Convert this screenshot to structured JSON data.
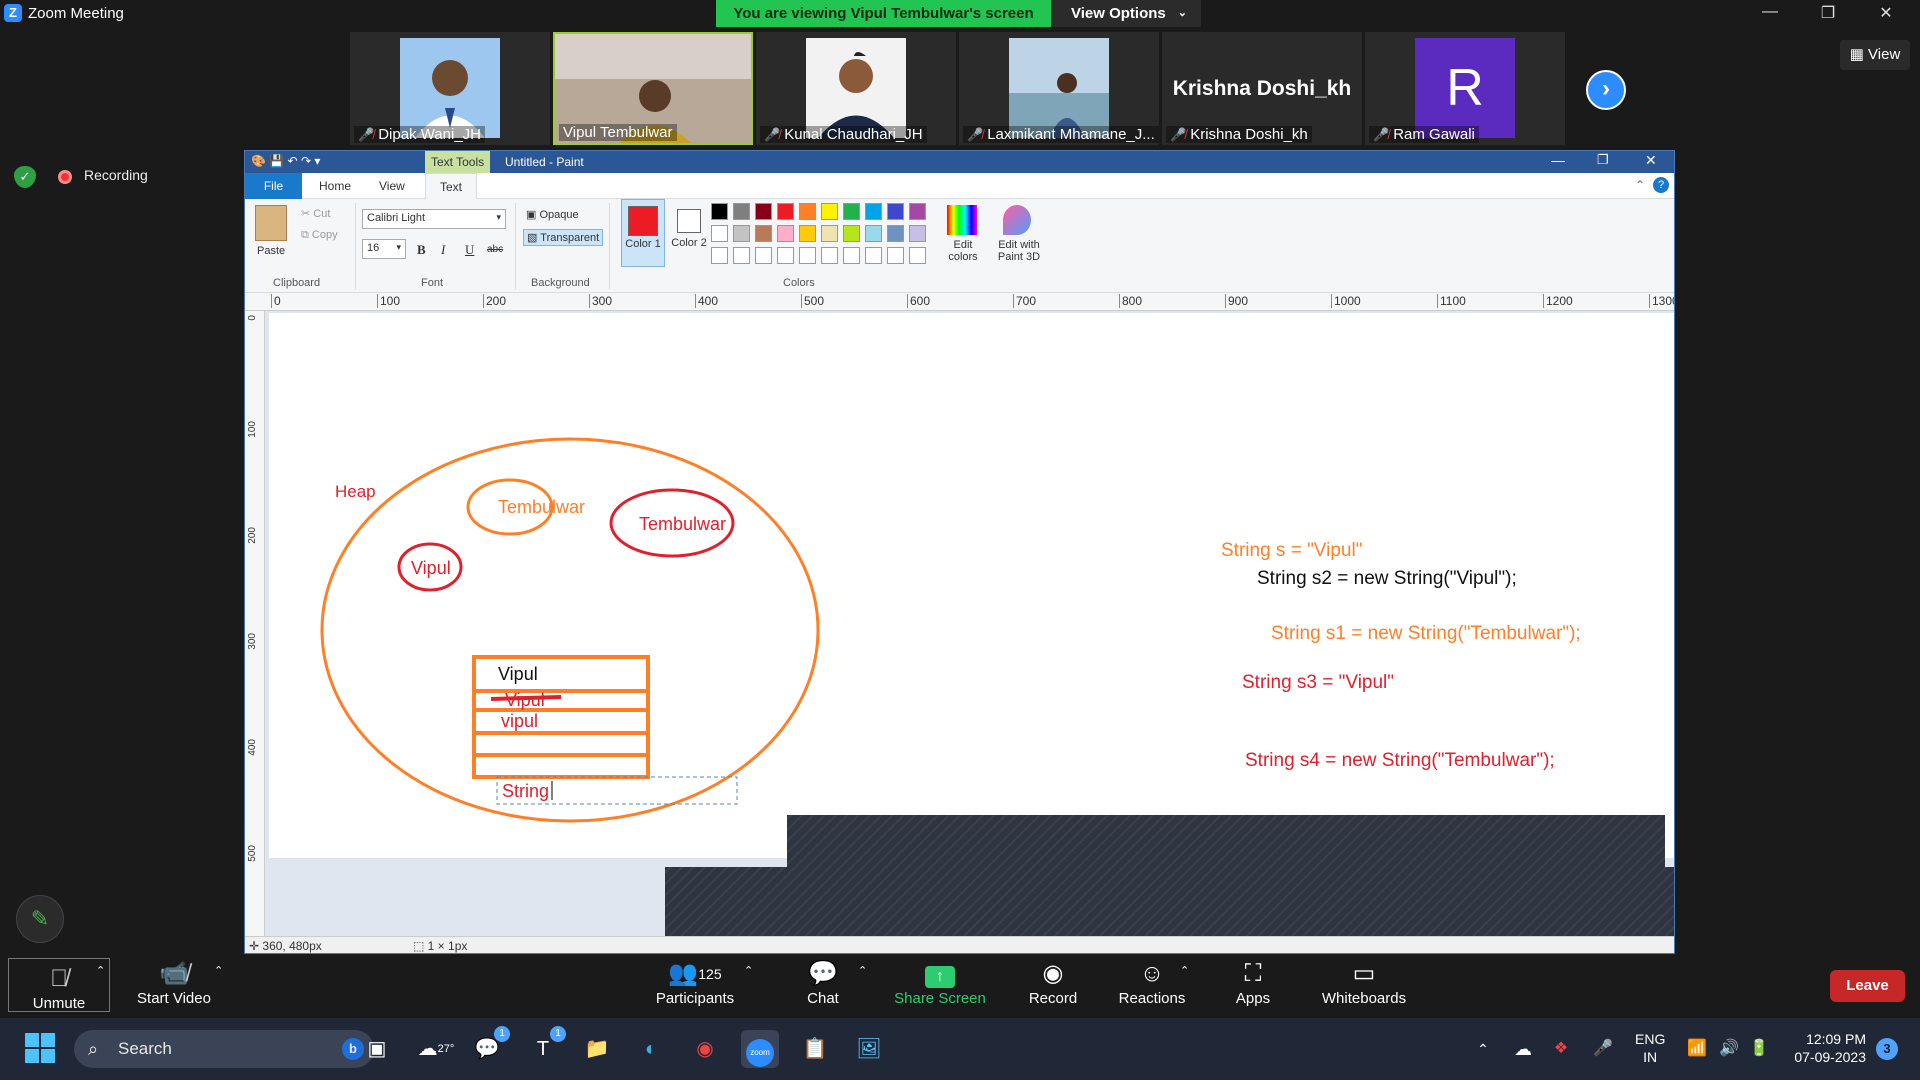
{
  "window": {
    "title": "Zoom Meeting"
  },
  "share_banner": {
    "text": "You are viewing Vipul Tembulwar's screen",
    "view_options": "View Options"
  },
  "participants": [
    {
      "name": "Dipak Wani_JH",
      "muted": true
    },
    {
      "name": "Vipul Tembulwar",
      "muted": false
    },
    {
      "name": "Kunal Chaudhari_JH",
      "muted": true
    },
    {
      "name": "Laxmikant Mhamane_J...",
      "muted": true
    },
    {
      "name": "Krishna Doshi_kh",
      "muted": true,
      "display_text": "Krishna Doshi_kh"
    },
    {
      "name": "Ram Gawali",
      "muted": true,
      "initial": "R"
    }
  ],
  "view_button": "View",
  "recording": {
    "label": "Recording"
  },
  "paint": {
    "text_tools_label": "Text Tools",
    "title": "Untitled - Paint",
    "tabs": [
      "File",
      "Home",
      "View",
      "Text"
    ],
    "clipboard": {
      "paste": "Paste",
      "cut": "Cut",
      "copy": "Copy",
      "group": "Clipboard"
    },
    "font": {
      "family": "Calibri Light",
      "size": "16",
      "bold": "B",
      "italic": "I",
      "underline": "U",
      "strike": "abc",
      "group": "Font"
    },
    "background": {
      "opaque": "Opaque",
      "transparent": "Transparent",
      "group": "Background"
    },
    "colors": {
      "color1_label": "Color 1",
      "color2_label": "Color 2",
      "edit": "Edit colors",
      "paint3d": "Edit with Paint 3D",
      "group": "Colors",
      "color1": "#ed1c24",
      "color2": "#ffffff",
      "palette_row1": [
        "#000000",
        "#7f7f7f",
        "#880015",
        "#ed1c24",
        "#ff7f27",
        "#fff200",
        "#22b14c",
        "#00a2e8",
        "#3f48cc",
        "#a349a4"
      ],
      "palette_row2": [
        "#ffffff",
        "#c3c3c3",
        "#b97a57",
        "#ffaec9",
        "#ffc90e",
        "#efe4b0",
        "#b5e61d",
        "#99d9ea",
        "#7092be",
        "#c8bfe7"
      ]
    },
    "ruler_h": [
      "0",
      "100",
      "200",
      "300",
      "400",
      "500",
      "600",
      "700",
      "800",
      "900",
      "1000",
      "1100",
      "1200",
      "1300"
    ],
    "ruler_v": [
      "0",
      "100",
      "200",
      "300",
      "400",
      "500"
    ],
    "status": {
      "cursor": "360, 480px",
      "selection": "1 × 1px"
    },
    "drawing": {
      "heap": "Heap",
      "pool_items": [
        "Tembulwar",
        "Tembulwar",
        "Vipul"
      ],
      "table_rows": [
        "Vipul",
        "Vipul",
        "vipul",
        "",
        ""
      ],
      "typing": "String",
      "code": [
        "String s = \"Vipul\"",
        "String s2 = new String(\"Vipul\");",
        "String s1 = new String(\"Tembulwar\");",
        "String s3 = \"Vipul\"",
        "String s4 = new String(\"Tembulwar\");"
      ]
    }
  },
  "toolbar": {
    "unmute": "Unmute",
    "start_video": "Start Video",
    "participants": "Participants",
    "participant_count": "125",
    "chat": "Chat",
    "share": "Share Screen",
    "record": "Record",
    "reactions": "Reactions",
    "apps": "Apps",
    "whiteboards": "Whiteboards",
    "leave": "Leave"
  },
  "taskbar": {
    "search": "Search",
    "weather": "27°",
    "badges": {
      "teams": "1",
      "teams2": "1"
    },
    "lang": [
      "ENG",
      "IN"
    ],
    "time": "12:09 PM",
    "date": "07-09-2023",
    "notifications": "3"
  }
}
